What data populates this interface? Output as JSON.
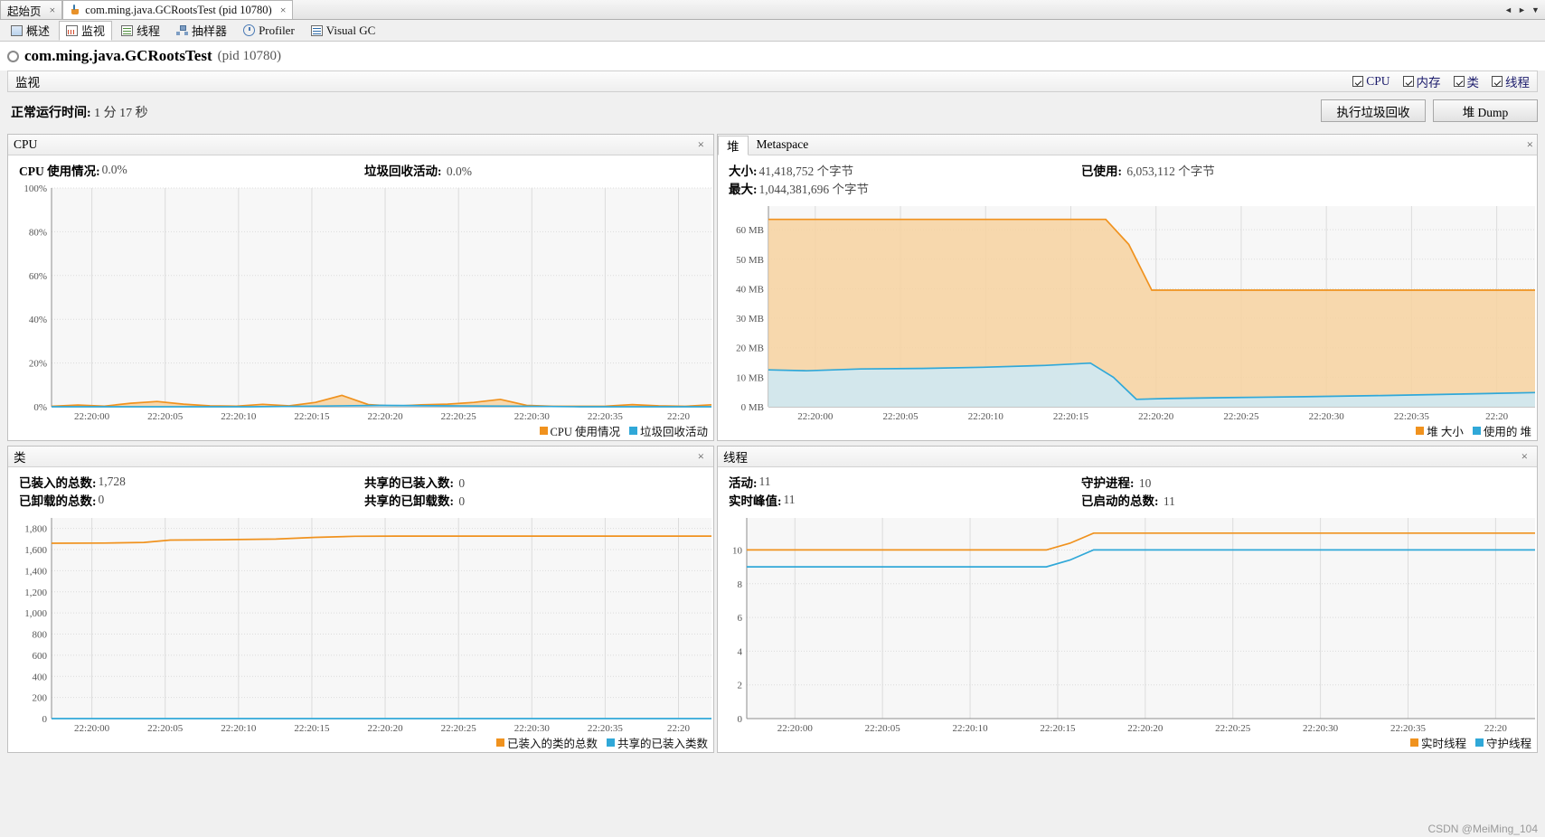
{
  "window_tabs": [
    {
      "label": "起始页",
      "icon": "none",
      "active": false,
      "close": "×"
    },
    {
      "label": "com.ming.java.GCRootsTest (pid 10780)",
      "icon": "java-icon",
      "active": true,
      "close": "×"
    }
  ],
  "nav_arrows": {
    "left": "◄",
    "right": "►",
    "down": "▼"
  },
  "view_tabs": [
    {
      "label": "概述",
      "icon": "overview-icon",
      "active": false
    },
    {
      "label": "监视",
      "icon": "monitor-icon",
      "active": true
    },
    {
      "label": "线程",
      "icon": "threads-icon",
      "active": false
    },
    {
      "label": "抽样器",
      "icon": "sampler-icon",
      "active": false
    },
    {
      "label": "Profiler",
      "icon": "profiler-icon",
      "active": false
    },
    {
      "label": "Visual GC",
      "icon": "visualgc-icon",
      "active": false
    }
  ],
  "process": {
    "name": "com.ming.java.GCRootsTest",
    "pid": "(pid 10780)"
  },
  "monitor_bar": {
    "title": "监视",
    "checkboxes": [
      {
        "label": "CPU",
        "checked": true
      },
      {
        "label": "内存",
        "checked": true
      },
      {
        "label": "类",
        "checked": true
      },
      {
        "label": "线程",
        "checked": true
      }
    ]
  },
  "uptime": {
    "label": "正常运行时间:",
    "value": "1 分 17 秒"
  },
  "buttons": [
    {
      "label": "执行垃圾回收"
    },
    {
      "label": "堆 Dump"
    }
  ],
  "panels": {
    "cpu": {
      "title": "CPU",
      "close": "×",
      "stats": [
        {
          "label": "CPU 使用情况:",
          "value": "0.0%"
        },
        {
          "label": "垃圾回收活动:",
          "value": "0.0%"
        }
      ]
    },
    "heap": {
      "tabs": [
        {
          "label": "堆",
          "active": true
        },
        {
          "label": "Metaspace",
          "active": false
        }
      ],
      "close": "×",
      "stats": [
        {
          "label": "大小:",
          "value": "41,418,752 个字节"
        },
        {
          "label": "最大:",
          "value": "1,044,381,696 个字节"
        },
        {
          "label": "已使用:",
          "value": "6,053,112 个字节"
        }
      ]
    },
    "classes": {
      "title": "类",
      "close": "×",
      "stats": [
        {
          "label": "已装入的总数:",
          "value": "1,728"
        },
        {
          "label": "已卸载的总数:",
          "value": "0"
        },
        {
          "label": "共享的已装入数:",
          "value": "0"
        },
        {
          "label": "共享的已卸载数:",
          "value": "0"
        }
      ]
    },
    "threads": {
      "title": "线程",
      "close": "×",
      "stats": [
        {
          "label": "活动:",
          "value": "11"
        },
        {
          "label": "实时峰值:",
          "value": "11"
        },
        {
          "label": "守护进程:",
          "value": "10"
        },
        {
          "label": "已启动的总数:",
          "value": "11"
        }
      ]
    }
  },
  "colors": {
    "orange": "#f0921e",
    "orange_fill": "#f7d2a0",
    "blue": "#30a8d8",
    "blue_fill": "#cdeaf7",
    "grid": "#dcdcdc",
    "plot_bg": "#f7f7f7",
    "accent_text": "#1b1b6b"
  },
  "watermark": "CSDN @MeiMing_104",
  "chart_data": [
    {
      "type": "area",
      "name": "cpu",
      "title": "CPU",
      "xlabel": "",
      "ylabel": "",
      "ylim": [
        0,
        100
      ],
      "yticks": [
        "0%",
        "20%",
        "40%",
        "60%",
        "80%",
        "100%"
      ],
      "ytick_values": [
        0,
        20,
        40,
        60,
        80,
        100
      ],
      "xticks": [
        "22:20:00",
        "22:20:05",
        "22:20:10",
        "22:20:15",
        "22:20:20",
        "22:20:25",
        "22:20:30",
        "22:20:35",
        "22:20"
      ],
      "grid": true,
      "legend": [
        {
          "name": "CPU 使用情况",
          "color": "#f0921e"
        },
        {
          "name": "垃圾回收活动",
          "color": "#30a8d8"
        }
      ],
      "series": [
        {
          "name": "CPU 使用情况",
          "color": "#f0921e",
          "x": [
            0,
            4,
            8,
            12,
            16,
            20,
            24,
            28,
            32,
            36,
            40,
            44,
            48,
            52,
            56,
            60,
            64,
            68,
            72,
            76,
            80,
            84,
            88,
            92,
            96,
            100
          ],
          "values": [
            0.2,
            0.8,
            0.3,
            1.6,
            2.4,
            1.2,
            0.4,
            0.3,
            1.1,
            0.4,
            2.0,
            5.2,
            1.0,
            0.3,
            0.9,
            1.2,
            2.0,
            3.4,
            0.6,
            0.2,
            0.2,
            0.3,
            1.0,
            0.4,
            0.2,
            0.9
          ]
        },
        {
          "name": "垃圾回收活动",
          "color": "#30a8d8",
          "x": [
            0,
            10,
            20,
            30,
            40,
            50,
            60,
            70,
            80,
            90,
            100
          ],
          "values": [
            0,
            0,
            0,
            0,
            0.3,
            0.6,
            0.4,
            0.3,
            0,
            0,
            0
          ]
        }
      ]
    },
    {
      "type": "area",
      "name": "heap",
      "title": "堆",
      "xlabel": "",
      "ylabel": "MB",
      "ylim": [
        0,
        68
      ],
      "yticks": [
        "0 MB",
        "10 MB",
        "20 MB",
        "30 MB",
        "40 MB",
        "50 MB",
        "60 MB"
      ],
      "ytick_values": [
        0,
        10,
        20,
        30,
        40,
        50,
        60
      ],
      "xticks": [
        "22:20:00",
        "22:20:05",
        "22:20:10",
        "22:20:15",
        "22:20:20",
        "22:20:25",
        "22:20:30",
        "22:20:35",
        "22:20"
      ],
      "grid": true,
      "legend": [
        {
          "name": "堆 大小",
          "color": "#f0921e"
        },
        {
          "name": "使用的 堆",
          "color": "#30a8d8"
        }
      ],
      "series": [
        {
          "name": "堆 大小",
          "color": "#f0921e",
          "x": [
            0,
            10,
            20,
            30,
            40,
            44,
            47,
            50,
            60,
            70,
            80,
            90,
            100
          ],
          "values": [
            63.5,
            63.5,
            63.5,
            63.5,
            63.5,
            63.5,
            55,
            39.5,
            39.5,
            39.5,
            39.5,
            39.5,
            39.5
          ]
        },
        {
          "name": "使用的 堆",
          "color": "#30a8d8",
          "x": [
            0,
            5,
            12,
            20,
            28,
            36,
            42,
            45,
            48,
            52,
            60,
            70,
            80,
            90,
            100
          ],
          "values": [
            12.5,
            12.2,
            12.8,
            13.0,
            13.4,
            14.0,
            14.8,
            10.0,
            2.5,
            2.8,
            3.1,
            3.4,
            3.8,
            4.3,
            4.8
          ]
        }
      ]
    },
    {
      "type": "line",
      "name": "classes",
      "title": "类",
      "xlabel": "",
      "ylabel": "",
      "ylim": [
        0,
        1900
      ],
      "yticks": [
        "0",
        "200",
        "400",
        "600",
        "800",
        "1,000",
        "1,200",
        "1,400",
        "1,600",
        "1,800"
      ],
      "ytick_values": [
        0,
        200,
        400,
        600,
        800,
        1000,
        1200,
        1400,
        1600,
        1800
      ],
      "xticks": [
        "22:20:00",
        "22:20:05",
        "22:20:10",
        "22:20:15",
        "22:20:20",
        "22:20:25",
        "22:20:30",
        "22:20:35",
        "22:20"
      ],
      "grid": true,
      "legend": [
        {
          "name": "已装入的类的总数",
          "color": "#f0921e"
        },
        {
          "name": "共享的已装入类数",
          "color": "#30a8d8"
        }
      ],
      "series": [
        {
          "name": "已装入的类的总数",
          "color": "#f0921e",
          "x": [
            0,
            8,
            14,
            18,
            26,
            34,
            40,
            46,
            52,
            60,
            70,
            80,
            90,
            100
          ],
          "values": [
            1660,
            1662,
            1668,
            1690,
            1694,
            1700,
            1716,
            1726,
            1728,
            1728,
            1728,
            1728,
            1728,
            1728
          ]
        },
        {
          "name": "共享的已装入类数",
          "color": "#30a8d8",
          "x": [
            0,
            50,
            100
          ],
          "values": [
            0,
            0,
            0
          ]
        }
      ]
    },
    {
      "type": "line",
      "name": "threads",
      "title": "线程",
      "xlabel": "",
      "ylabel": "",
      "ylim": [
        0,
        11.9
      ],
      "yticks": [
        "0",
        "2",
        "4",
        "6",
        "8",
        "10"
      ],
      "ytick_values": [
        0,
        2,
        4,
        6,
        8,
        10
      ],
      "xticks": [
        "22:20:00",
        "22:20:05",
        "22:20:10",
        "22:20:15",
        "22:20:20",
        "22:20:25",
        "22:20:30",
        "22:20:35",
        "22:20"
      ],
      "grid": true,
      "legend": [
        {
          "name": "实时线程",
          "color": "#f0921e"
        },
        {
          "name": "守护线程",
          "color": "#30a8d8"
        }
      ],
      "series": [
        {
          "name": "实时线程",
          "color": "#f0921e",
          "x": [
            0,
            20,
            38,
            41,
            44,
            46,
            60,
            80,
            100
          ],
          "values": [
            10,
            10,
            10,
            10.4,
            11,
            11,
            11,
            11,
            11
          ]
        },
        {
          "name": "守护线程",
          "color": "#30a8d8",
          "x": [
            0,
            20,
            38,
            41,
            44,
            46,
            60,
            80,
            100
          ],
          "values": [
            9,
            9,
            9,
            9.4,
            10,
            10,
            10,
            10,
            10
          ]
        }
      ]
    }
  ]
}
